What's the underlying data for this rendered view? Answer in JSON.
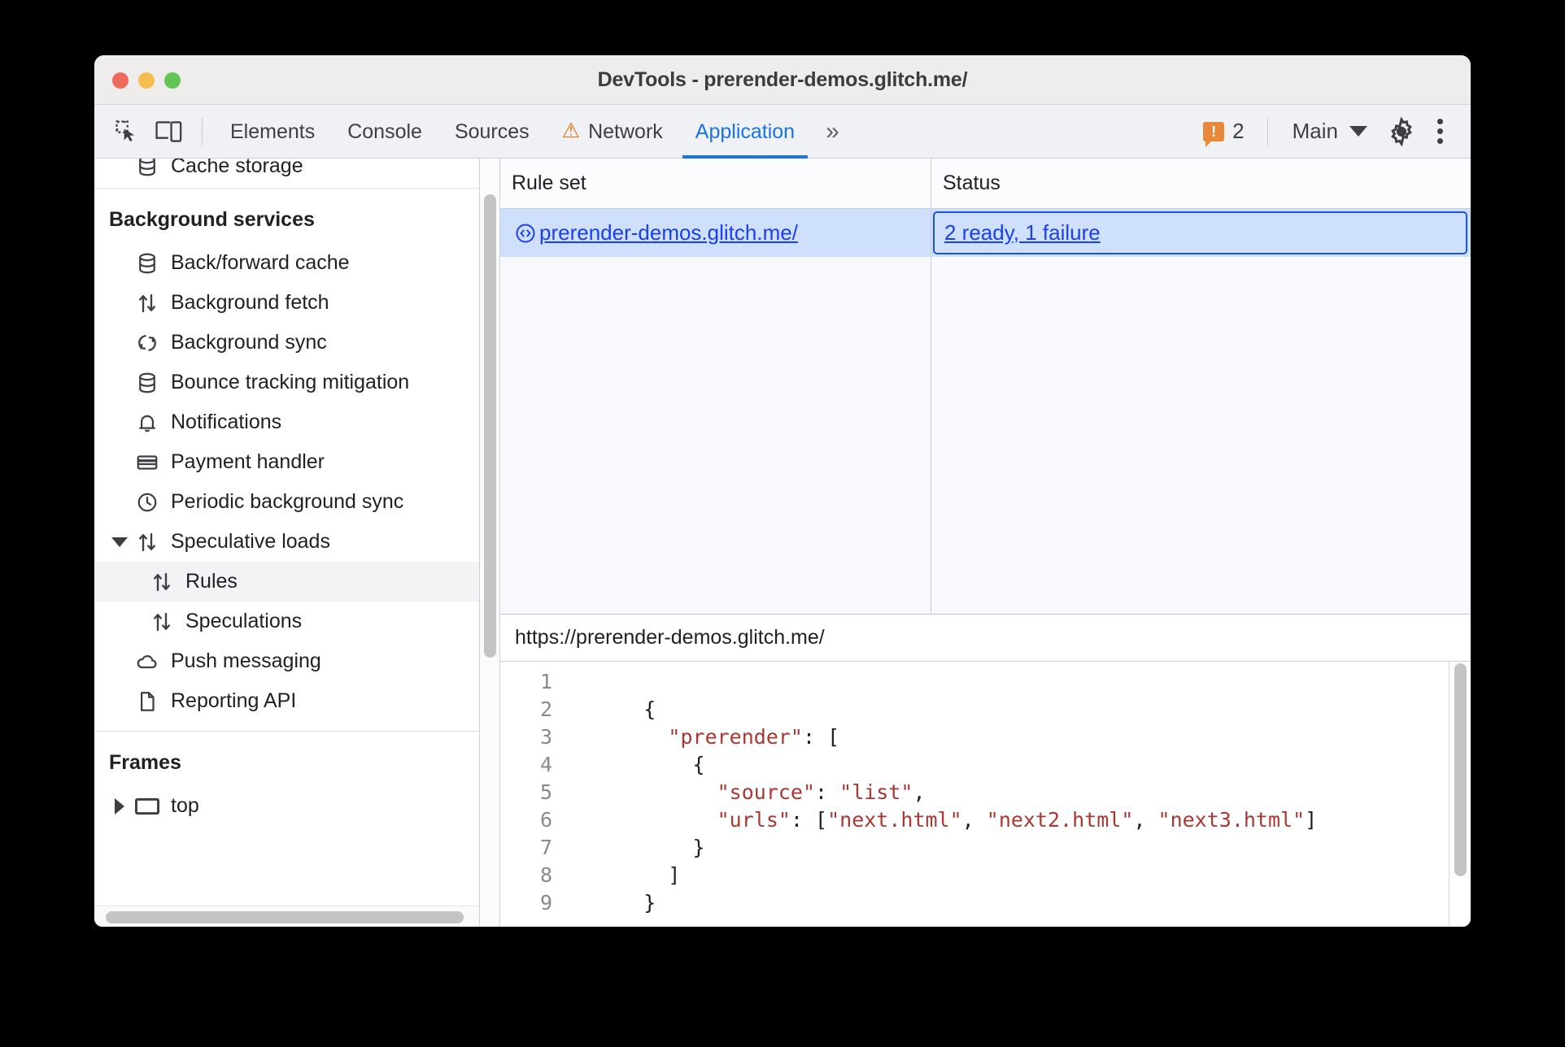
{
  "window": {
    "title": "DevTools - prerender-demos.glitch.me/",
    "traffic_lights": [
      "close-red",
      "minimize-yellow",
      "maximize-green"
    ]
  },
  "toolbar": {
    "inspect_icon": "inspect-element-icon",
    "device_icon": "device-toolbar-icon",
    "tabs": [
      {
        "label": "Elements",
        "active": false,
        "warning": false
      },
      {
        "label": "Console",
        "active": false,
        "warning": false
      },
      {
        "label": "Sources",
        "active": false,
        "warning": false
      },
      {
        "label": "Network",
        "active": false,
        "warning": true
      },
      {
        "label": "Application",
        "active": true,
        "warning": false
      }
    ],
    "more_tabs": "»",
    "issues_count": "2",
    "issues_badge_glyph": "!",
    "context_label": "Main",
    "settings_icon": "gear-icon",
    "more_icon": "more-options-icon",
    "accent_color": "#1a73e8",
    "warning_color": "#e8710a"
  },
  "sidebar": {
    "clipped_item": {
      "label": "Cache storage",
      "icon": "database-icon"
    },
    "sections": [
      {
        "title": "Background services",
        "items": [
          {
            "label": "Back/forward cache",
            "icon": "database-icon",
            "indent": 1,
            "selected": false,
            "twisty": ""
          },
          {
            "label": "Background fetch",
            "icon": "updown-arrows-icon",
            "indent": 1,
            "selected": false,
            "twisty": ""
          },
          {
            "label": "Background sync",
            "icon": "sync-icon",
            "indent": 1,
            "selected": false,
            "twisty": ""
          },
          {
            "label": "Bounce tracking mitigation",
            "icon": "database-icon",
            "indent": 1,
            "selected": false,
            "twisty": ""
          },
          {
            "label": "Notifications",
            "icon": "bell-icon",
            "indent": 1,
            "selected": false,
            "twisty": ""
          },
          {
            "label": "Payment handler",
            "icon": "credit-card-icon",
            "indent": 1,
            "selected": false,
            "twisty": ""
          },
          {
            "label": "Periodic background sync",
            "icon": "clock-icon",
            "indent": 1,
            "selected": false,
            "twisty": ""
          },
          {
            "label": "Speculative loads",
            "icon": "updown-arrows-icon",
            "indent": 1,
            "selected": false,
            "twisty": "down"
          },
          {
            "label": "Rules",
            "icon": "updown-arrows-icon",
            "indent": 2,
            "selected": true,
            "twisty": ""
          },
          {
            "label": "Speculations",
            "icon": "updown-arrows-icon",
            "indent": 2,
            "selected": false,
            "twisty": ""
          },
          {
            "label": "Push messaging",
            "icon": "cloud-icon",
            "indent": 1,
            "selected": false,
            "twisty": ""
          },
          {
            "label": "Reporting API",
            "icon": "document-icon",
            "indent": 1,
            "selected": false,
            "twisty": ""
          }
        ]
      },
      {
        "title": "Frames",
        "items": [
          {
            "label": "top",
            "icon": "frame-icon",
            "indent": 1,
            "selected": false,
            "twisty": "right"
          }
        ]
      }
    ]
  },
  "ruleset_table": {
    "columns": [
      "Rule set",
      "Status"
    ],
    "rows": [
      {
        "rule_set": "prerender-demos.glitch.me/",
        "rule_set_icon": "code-brackets-icon",
        "status": "2 ready, 1 failure",
        "selected": true,
        "status_focused": true
      }
    ]
  },
  "preview": {
    "url": "https://prerender-demos.glitch.me/",
    "code_lines": [
      {
        "n": "1",
        "text": ""
      },
      {
        "n": "2",
        "text": "      {"
      },
      {
        "n": "3",
        "text": "        \"prerender\": ["
      },
      {
        "n": "4",
        "text": "          {"
      },
      {
        "n": "5",
        "text": "            \"source\": \"list\","
      },
      {
        "n": "6",
        "text": "            \"urls\": [\"next.html\", \"next2.html\", \"next3.html\"]"
      },
      {
        "n": "7",
        "text": "          }"
      },
      {
        "n": "8",
        "text": "        ]"
      },
      {
        "n": "9",
        "text": "      }"
      }
    ],
    "string_color": "#aa3731"
  }
}
